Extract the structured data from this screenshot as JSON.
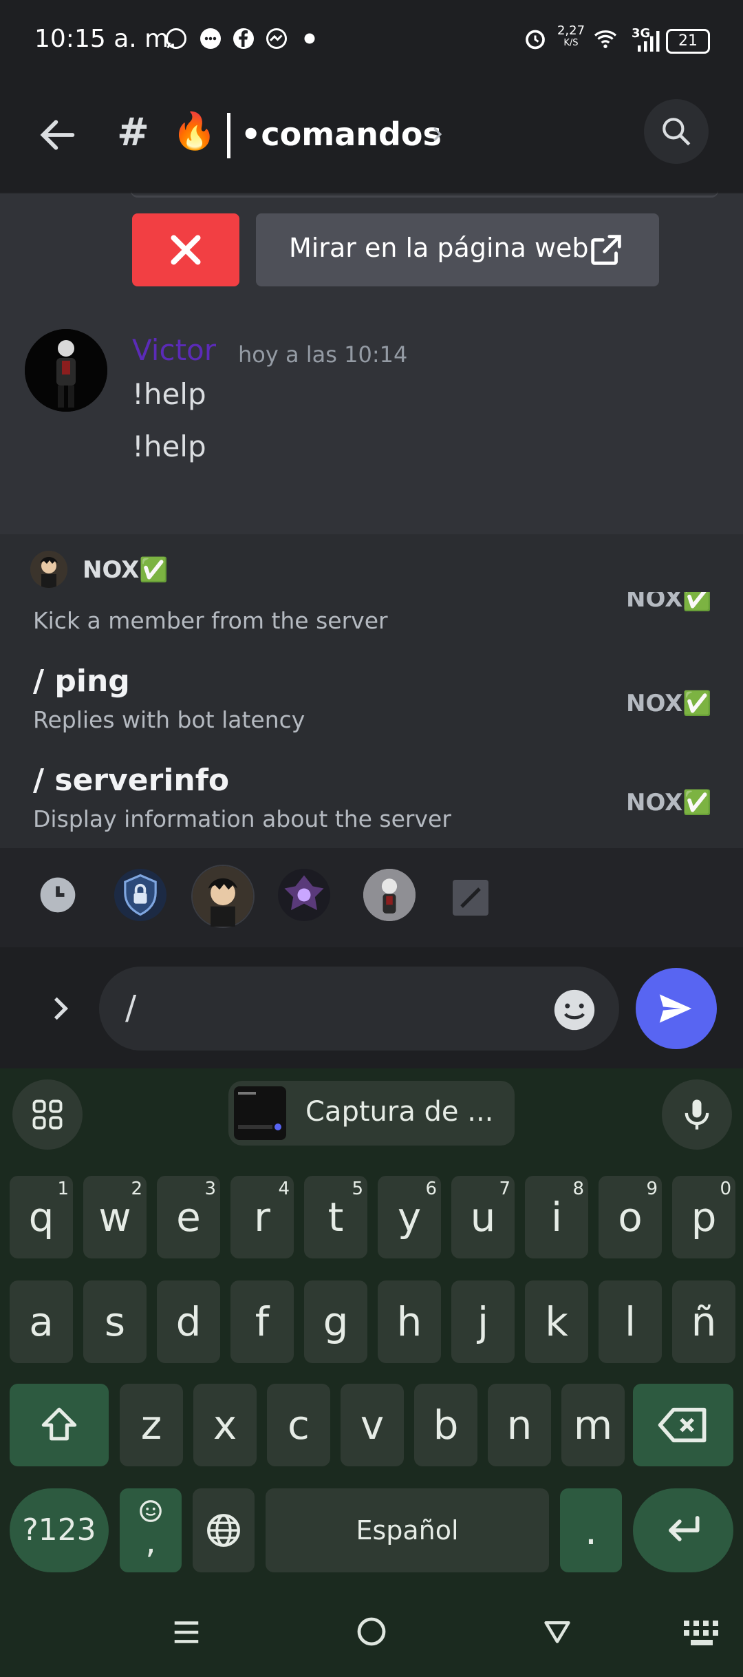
{
  "status_bar": {
    "time": "10:15 a. m.",
    "speed_value": "2,27",
    "speed_unit": "K/S",
    "network": "3G",
    "battery": "21"
  },
  "header": {
    "channel_name": "•comandos"
  },
  "embed": {
    "web_button_label": "Mirar en la página web"
  },
  "message": {
    "author": "Victor",
    "author_color": "#5b2bb8",
    "timestamp": "hoy a las 10:14",
    "lines": [
      "!help",
      "!help"
    ]
  },
  "autocomplete": {
    "bot_name": "NOX✅",
    "commands": [
      {
        "name": "",
        "description": "Kick a member from the server",
        "source": "NOX✅"
      },
      {
        "name": "/ ping",
        "description": "Replies with bot latency",
        "source": "NOX✅"
      },
      {
        "name": "/ serverinfo",
        "description": "Display information about the server",
        "source": "NOX✅"
      }
    ]
  },
  "composer": {
    "text": "/"
  },
  "keyboard": {
    "suggestion": "Captura de ...",
    "row1": [
      {
        "k": "q",
        "h": "1"
      },
      {
        "k": "w",
        "h": "2"
      },
      {
        "k": "e",
        "h": "3"
      },
      {
        "k": "r",
        "h": "4"
      },
      {
        "k": "t",
        "h": "5"
      },
      {
        "k": "y",
        "h": "6"
      },
      {
        "k": "u",
        "h": "7"
      },
      {
        "k": "i",
        "h": "8"
      },
      {
        "k": "o",
        "h": "9"
      },
      {
        "k": "p",
        "h": "0"
      }
    ],
    "row2": [
      "a",
      "s",
      "d",
      "f",
      "g",
      "h",
      "j",
      "k",
      "l",
      "ñ"
    ],
    "row3": [
      "z",
      "x",
      "c",
      "v",
      "b",
      "n",
      "m"
    ],
    "symbols_label": "?123",
    "comma_label": ",",
    "space_label": "Español",
    "period_label": "."
  },
  "colors": {
    "accent": "#5865f2",
    "danger": "#f23f43",
    "keyboard_bg": "#1b2a1f"
  }
}
